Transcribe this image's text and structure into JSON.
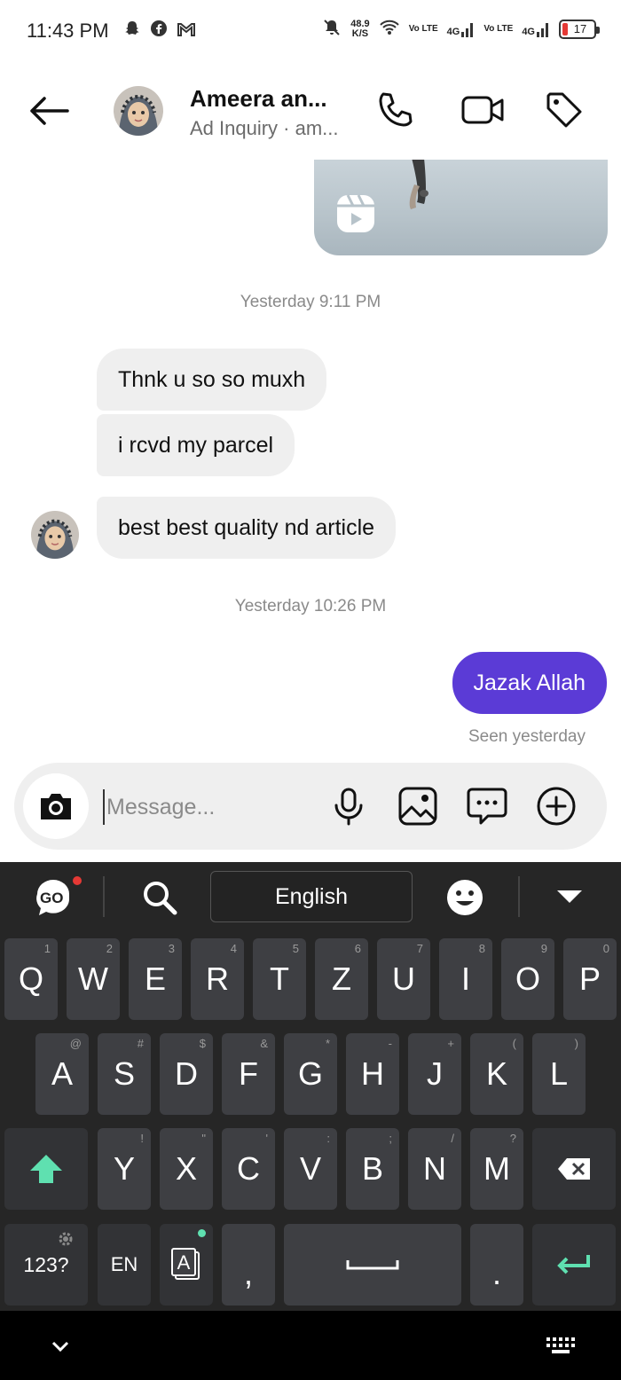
{
  "status_bar": {
    "time": "11:43 PM",
    "net_speed_value": "48.9",
    "net_speed_unit": "K/S",
    "sim1_type": "Vo LTE",
    "sim1_gen": "4G",
    "sim2_type": "Vo LTE",
    "sim2_gen": "4G",
    "battery": "17"
  },
  "header": {
    "contact_name": "Ameera an...",
    "subtitle": "Ad Inquiry · am..."
  },
  "chat": {
    "timestamp_1": "Yesterday 9:11 PM",
    "timestamp_2": "Yesterday 10:26 PM",
    "received": [
      "Thnk u so so muxh",
      "i rcvd my parcel",
      "best best quality nd article"
    ],
    "sent": [
      "Jazak Allah"
    ],
    "seen_status": "Seen yesterday"
  },
  "composer": {
    "placeholder": "Message..."
  },
  "keyboard": {
    "language": "English",
    "go_badge": "GO",
    "row1": [
      [
        "Q",
        "1"
      ],
      [
        "W",
        "2"
      ],
      [
        "E",
        "3"
      ],
      [
        "R",
        "4"
      ],
      [
        "T",
        "5"
      ],
      [
        "Z",
        "6"
      ],
      [
        "U",
        "7"
      ],
      [
        "I",
        "8"
      ],
      [
        "O",
        "9"
      ],
      [
        "P",
        "0"
      ]
    ],
    "row2": [
      [
        "A",
        "@"
      ],
      [
        "S",
        "#"
      ],
      [
        "D",
        "$"
      ],
      [
        "F",
        "&"
      ],
      [
        "G",
        "*"
      ],
      [
        "H",
        "-"
      ],
      [
        "J",
        "+"
      ],
      [
        "K",
        "("
      ],
      [
        "L",
        ")"
      ]
    ],
    "row3": [
      [
        "Y",
        "!"
      ],
      [
        "X",
        "\""
      ],
      [
        "C",
        "'"
      ],
      [
        "V",
        ":"
      ],
      [
        "B",
        ";"
      ],
      [
        "N",
        "/"
      ],
      [
        "M",
        "?"
      ]
    ],
    "numbers_label": "123?",
    "lang_key_label": "EN",
    "comma": ",",
    "period": "."
  },
  "colors": {
    "accent": "#5b3bd6",
    "keyboard_bg": "#262626",
    "key_bg": "#3e3f43",
    "shift_green": "#5fe0b0"
  }
}
